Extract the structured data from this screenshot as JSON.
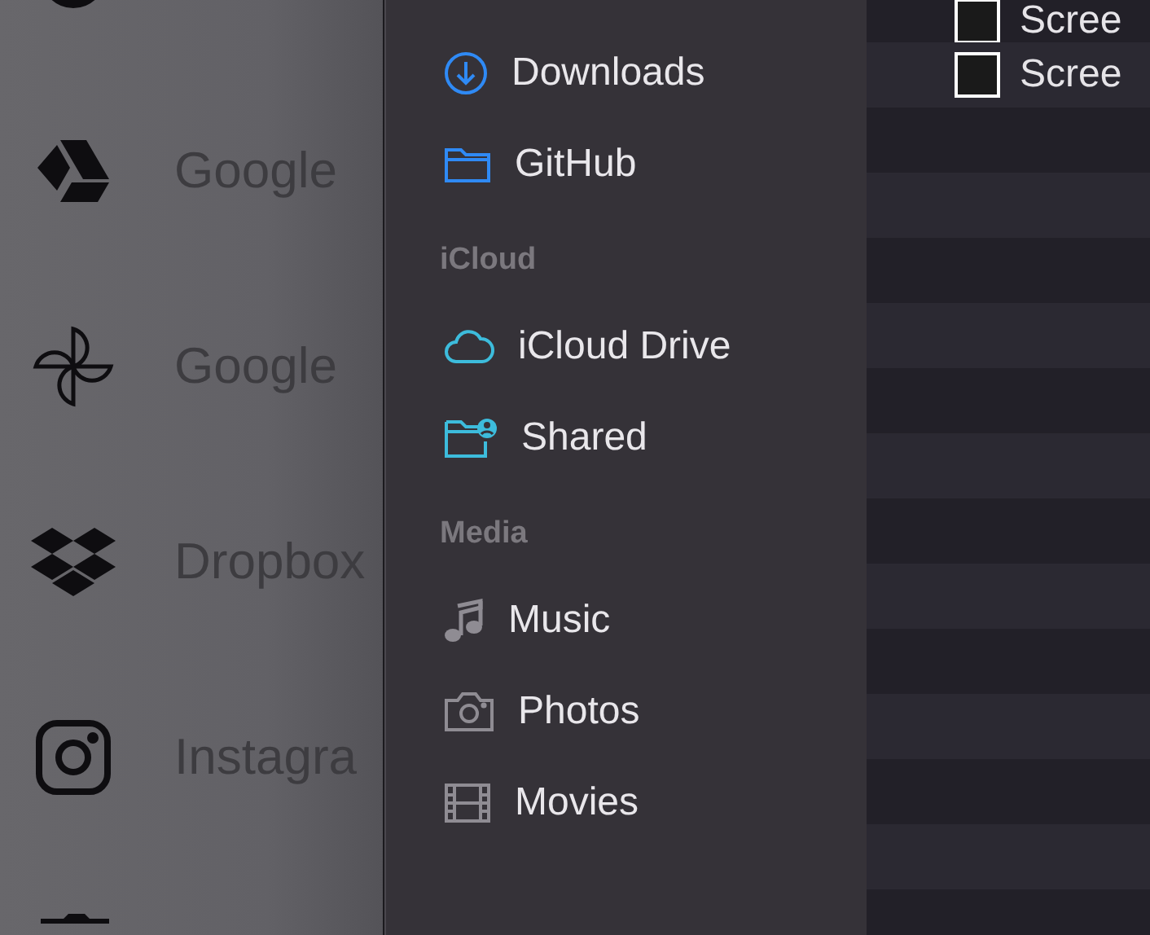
{
  "background_apps": [
    {
      "kind": "round"
    },
    {
      "kind": "drive",
      "label": "Google"
    },
    {
      "kind": "pinwheel",
      "label": "Google"
    },
    {
      "kind": "dropbox",
      "label": "Dropbox"
    },
    {
      "kind": "instagram",
      "label": "Instagra"
    },
    {
      "kind": "folder"
    }
  ],
  "sidebar": {
    "sections": [
      {
        "items": [
          {
            "kind": "downloads",
            "label": "Downloads"
          },
          {
            "kind": "folder",
            "label": "GitHub"
          }
        ]
      },
      {
        "header": "iCloud",
        "items": [
          {
            "kind": "cloud",
            "label": "iCloud Drive"
          },
          {
            "kind": "shared",
            "label": "Shared"
          }
        ]
      },
      {
        "header": "Media",
        "items": [
          {
            "kind": "music",
            "label": "Music"
          },
          {
            "kind": "photos",
            "label": "Photos"
          },
          {
            "kind": "movies",
            "label": "Movies"
          }
        ]
      }
    ]
  },
  "files": [
    {
      "name": "Scree"
    },
    {
      "name": "Scree"
    }
  ]
}
